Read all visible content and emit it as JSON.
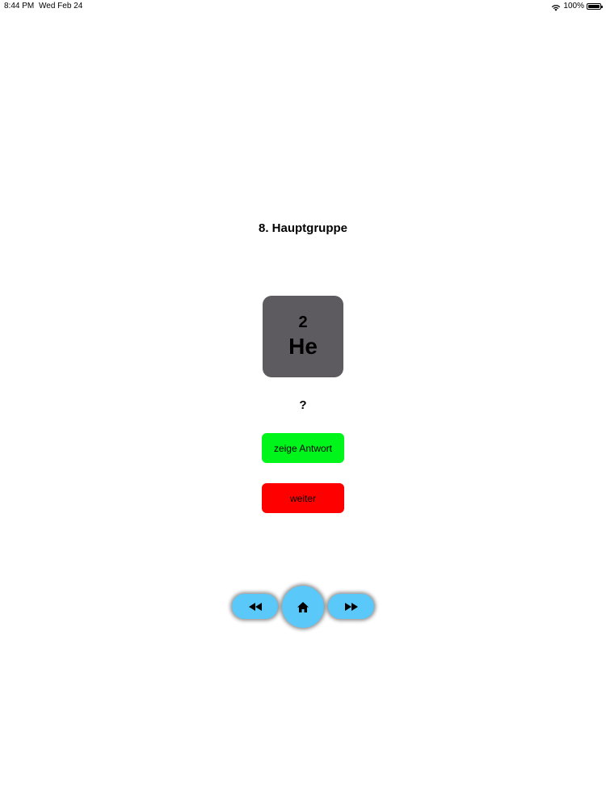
{
  "status_bar": {
    "time": "8:44 PM",
    "date": "Wed Feb 24",
    "battery": "100%",
    "battery_level": 1.0,
    "wifi_icon": "wifi-icon",
    "battery_icon": "battery-icon"
  },
  "quiz": {
    "group_title": "8. Hauptgruppe",
    "element": {
      "number": "2",
      "symbol": "He",
      "tile_color": "#5d5b60"
    },
    "answer_placeholder": "?",
    "show_answer_label": "zeige Antwort",
    "next_label": "weiter",
    "show_answer_color": "#00f51b",
    "next_color": "#ff0000"
  },
  "navigation": {
    "accent_color": "#5ac8f9",
    "previous_icon": "rewind-icon",
    "home_icon": "home-icon",
    "next_icon": "fast-forward-icon"
  }
}
